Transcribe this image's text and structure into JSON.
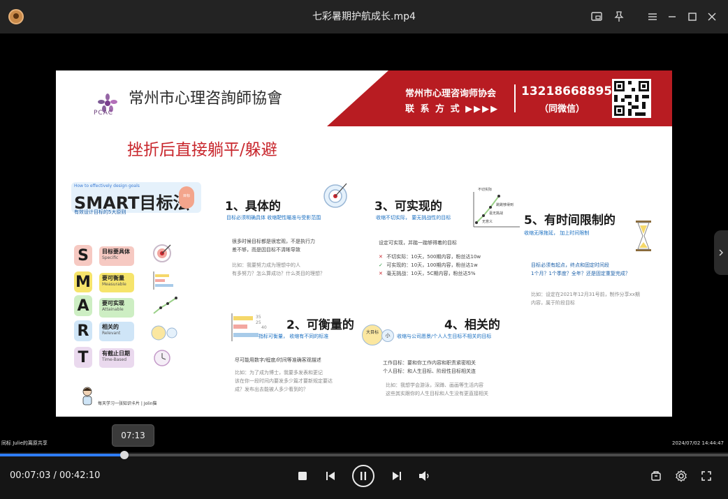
{
  "window": {
    "title": "七彩暑期护航成长.mp4"
  },
  "slide": {
    "org_name": "常州市心理咨詢師協會",
    "org_abbr": "PCAC",
    "banner": {
      "org": "常州市心理咨询师协会",
      "contact": "联 系 方 式 ▶▶▶▶",
      "phone": "13218668895",
      "wechat": "（同微信）"
    },
    "title": "挫折后直接躺平/躲避",
    "smart": {
      "caption": "How to effectively design goals",
      "heading": "SMART目标法",
      "subtitle": "有效设计目标的5大原则",
      "badge": "目标",
      "items": [
        {
          "letter": "S",
          "label": "目标要具体",
          "en": "Specific"
        },
        {
          "letter": "M",
          "label": "要可衡量",
          "en": "Measurable"
        },
        {
          "letter": "A",
          "label": "要可实现",
          "en": "Attainable"
        },
        {
          "letter": "R",
          "label": "相关的",
          "en": "Relevant"
        },
        {
          "letter": "T",
          "label": "有截止日期",
          "en": "Time-Based"
        }
      ],
      "footer": "每天学习一张知识卡片 | Jolin猫"
    },
    "sections": {
      "s1": {
        "title": "1、具体的",
        "sub": "目标必须明确具体   收缩靶性瞄准与受影范围",
        "lines": [
          "很多时候目标都是很宏观，不是执行力",
          "差不够，而是因目标不清晰导致"
        ],
        "example": [
          "比如：我要努力成为理想中的人",
          "有多努力？怎么算成功？什么类目的理想？"
        ]
      },
      "s2": {
        "title": "2、可衡量的",
        "sub": "指标可衡量，   收缩有不同的标准",
        "bars": [
          "35",
          "25",
          "40"
        ],
        "lines": [
          "尽可能用数字/程度/时间等准确客观描述"
        ],
        "example": [
          "比如：为了成为博士，我要多发表和更记",
          "该在你一段时间内要发多少篇才要新规定要达",
          "成？发布出去能被人多少看到的？"
        ]
      },
      "s3": {
        "title": "3、可实现的",
        "sub": "收缩不切实际，   要无挑战性的目标",
        "chart_labels": [
          "不切实际",
          "跳跳够得到",
          "毫无挑战",
          "无意义"
        ],
        "lines": [
          "设定可实现，并踮一踮够得着的目标"
        ],
        "options": [
          {
            "mark": "✕",
            "text": "不切实际：10天，500期内容，粉丝达10w"
          },
          {
            "mark": "✓",
            "text": "可实现的：10天，100期内容，粉丝达1w"
          },
          {
            "mark": "✕",
            "text": "毫无挑战：10天，5C期内容，粉丝达5%"
          }
        ]
      },
      "s4": {
        "title": "4、相关的",
        "sub": "收缩与公司愿景/个人人生目标不相关的目标",
        "circle_big": "大目标",
        "circle_small": "小",
        "lines": [
          "工作目标：要和你工作内容和职责紧密相关",
          "个人目标：和人生目标、阶段性目标相关连"
        ],
        "example": [
          "比如：我想学会游泳，深蹲、画画等生活内容",
          "这些其实跟你的人生目标和人生没有更直接相关"
        ]
      },
      "s5": {
        "title": "5、有时间限制的",
        "sub": "收缩无限拖延，   加上时间限制",
        "lines": [
          "目标必须有起点，终点和固定时间段",
          "1个月？1个季度？全年？还是固定重复完成？"
        ],
        "example": [
          "比如：设定在2021年12月31号前，制作分享xx期",
          "内容，属于阶段目标"
        ]
      }
    }
  },
  "overlay": {
    "left_tag": "同标 Julie的离原共享",
    "right_tag": "2024/07/02 14:44:47",
    "tooltip": "07:13"
  },
  "player": {
    "current": "00:07:03",
    "separator": " / ",
    "total": "00:42:10",
    "progress": 0.171
  },
  "colors": {
    "accent": "#2f7df6",
    "banner_red": "#b81c22"
  }
}
